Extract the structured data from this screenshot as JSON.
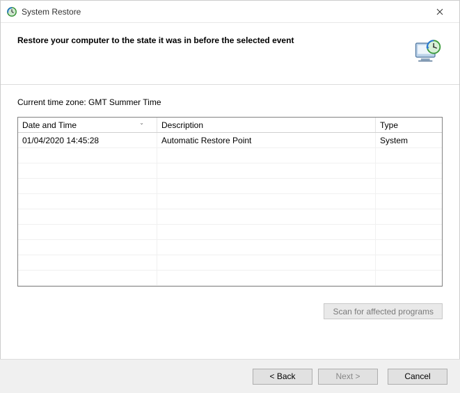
{
  "window": {
    "title": "System Restore"
  },
  "header": {
    "heading": "Restore your computer to the state it was in before the selected event"
  },
  "content": {
    "timezone_label": "Current time zone: GMT Summer Time",
    "columns": {
      "datetime": "Date and Time",
      "description": "Description",
      "type": "Type"
    },
    "rows": [
      {
        "datetime": "01/04/2020 14:45:28",
        "description": "Automatic Restore Point",
        "type": "System"
      }
    ],
    "scan_button": "Scan for affected programs"
  },
  "footer": {
    "back": "< Back",
    "next": "Next >",
    "cancel": "Cancel"
  }
}
